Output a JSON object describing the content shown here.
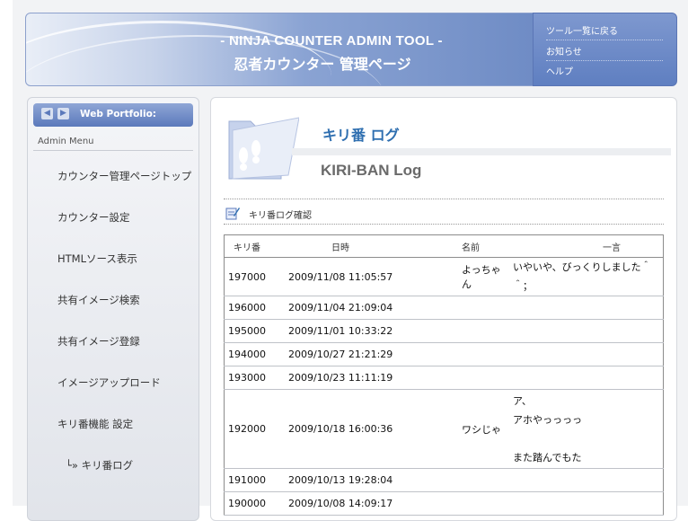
{
  "header": {
    "title_en": "- NINJA COUNTER ADMIN TOOL -",
    "title_jp": "忍者カウンター 管理ページ",
    "menu": [
      "ツール一覧に戻る",
      "お知らせ",
      "ヘルプ"
    ]
  },
  "sidebar": {
    "title": "Web Portfolio:",
    "subtitle": "Admin Menu",
    "items": [
      "カウンター管理ページトップ",
      "カウンター設定",
      "HTMLソース表示",
      "共有イメージ検索",
      "共有イメージ登録",
      "イメージアップロード",
      "キリ番機能 設定",
      "└» キリ番ログ"
    ]
  },
  "main": {
    "title_jp": "キリ番 ログ",
    "title_en": "KIRI-BAN Log",
    "section_title": "キリ番ログ確認",
    "columns": [
      "キリ番",
      "日時",
      "名前",
      "一言"
    ],
    "rows": [
      {
        "num": "197000",
        "date": "2009/11/08 11:05:57",
        "name": "よっちゃん",
        "comment": [
          "いやいや、びっくりしました＾＾；"
        ]
      },
      {
        "num": "196000",
        "date": "2009/11/04 21:09:04",
        "name": "",
        "comment": []
      },
      {
        "num": "195000",
        "date": "2009/11/01 10:33:22",
        "name": "",
        "comment": []
      },
      {
        "num": "194000",
        "date": "2009/10/27 21:21:29",
        "name": "",
        "comment": []
      },
      {
        "num": "193000",
        "date": "2009/10/23 11:11:19",
        "name": "",
        "comment": []
      },
      {
        "num": "192000",
        "date": "2009/10/18 16:00:36",
        "name": "ワシじゃ",
        "comment": [
          "ア、",
          "アホやっっっっ",
          "",
          "また踏んでもた"
        ]
      },
      {
        "num": "191000",
        "date": "2009/10/13 19:28:04",
        "name": "",
        "comment": []
      },
      {
        "num": "190000",
        "date": "2009/10/08 14:09:17",
        "name": "",
        "comment": []
      }
    ]
  },
  "colors": {
    "accent_blue": "#5f7fc1",
    "title_blue": "#2f6fb0"
  }
}
